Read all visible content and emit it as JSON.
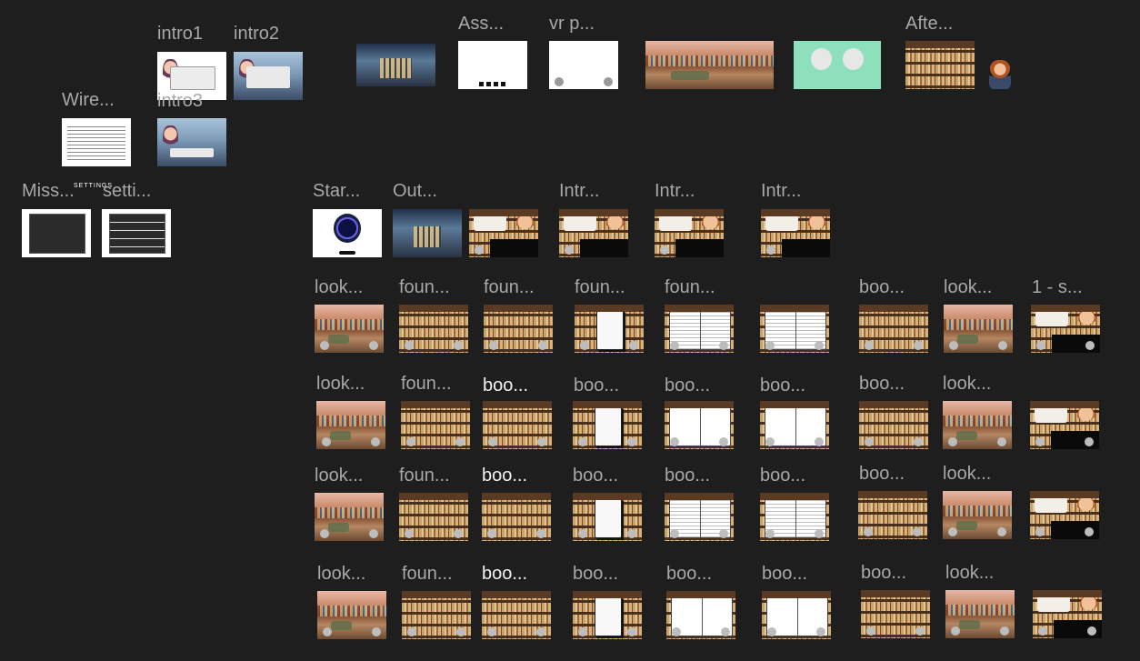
{
  "canvas": {
    "frames": {
      "intro1": "intro1",
      "intro2": "intro2",
      "intro3": "intro3",
      "wire": "Wire...",
      "miss": "Miss...",
      "settings_title": "SETTINGS",
      "setti": "setti...",
      "ass": "Ass...",
      "vr": "vr p...",
      "afte": "Afte...",
      "star": "Star...",
      "out": "Out...",
      "intr_a": "Intr...",
      "intr_b": "Intr...",
      "intr_c": "Intr..."
    },
    "rows": [
      {
        "labels": [
          "look...",
          "foun...",
          "foun...",
          "foun...",
          "foun...",
          "boo...",
          "look...",
          "1 - s..."
        ]
      },
      {
        "labels": [
          "look...",
          "foun...",
          "boo...",
          "boo...",
          "boo...",
          "boo...",
          "boo...",
          "look..."
        ]
      },
      {
        "labels": [
          "look...",
          "foun...",
          "boo...",
          "boo...",
          "boo...",
          "boo...",
          "boo...",
          "look..."
        ]
      },
      {
        "labels": [
          "look...",
          "foun...",
          "boo...",
          "boo...",
          "boo...",
          "boo...",
          "boo...",
          "look..."
        ]
      }
    ]
  }
}
